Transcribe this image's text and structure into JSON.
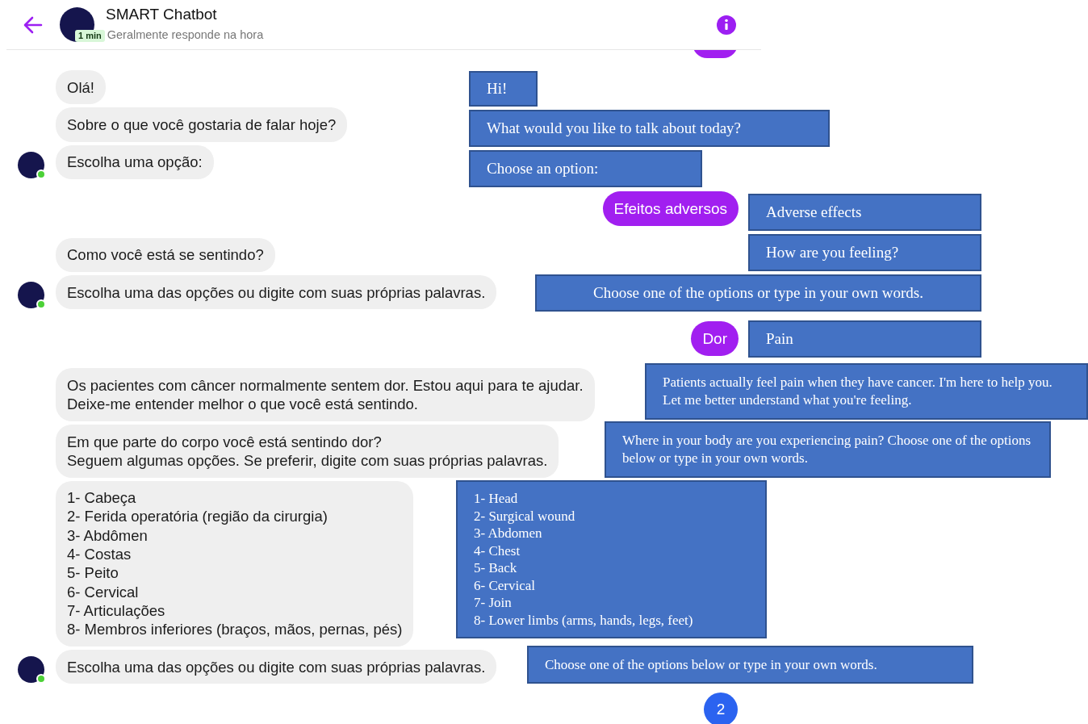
{
  "header": {
    "title": "SMART Chatbot",
    "badge": "1 min",
    "subtitle": "Geralmente responde na hora"
  },
  "messages": [
    {
      "kind": "bot",
      "lines": [
        "Olá!"
      ],
      "avatar": false
    },
    {
      "kind": "bot",
      "lines": [
        "Sobre o que você gostaria de falar hoje?"
      ],
      "avatar": false
    },
    {
      "kind": "bot",
      "lines": [
        "Escolha uma opção:"
      ],
      "avatar": true
    },
    {
      "kind": "user",
      "lines": [
        "Efeitos adversos"
      ]
    },
    {
      "kind": "bot",
      "lines": [
        "Como você está se sentindo?"
      ],
      "avatar": false
    },
    {
      "kind": "bot",
      "lines": [
        "Escolha uma das opções ou digite com suas próprias palavras."
      ],
      "avatar": true
    },
    {
      "kind": "user",
      "lines": [
        "Dor"
      ]
    },
    {
      "kind": "bot",
      "lines": [
        "Os pacientes com câncer normalmente sentem dor. Estou aqui para te ajudar.",
        "Deixe-me entender melhor o que você está sentindo."
      ],
      "avatar": false
    },
    {
      "kind": "bot",
      "lines": [
        "Em que parte do corpo você está sentindo dor?",
        "Seguem algumas opções. Se preferir, digite com suas próprias palavras."
      ],
      "avatar": false
    },
    {
      "kind": "bot",
      "lines": [
        "1- Cabeça",
        "2- Ferida operatória (região da cirurgia)",
        "3- Abdômen",
        "4- Costas",
        "5- Peito",
        "6- Cervical",
        "7- Articulações",
        "8- Membros inferiores (braços, mãos, pernas, pés)"
      ],
      "avatar": false
    },
    {
      "kind": "bot",
      "lines": [
        "Escolha uma das opções ou digite com suas próprias palavras."
      ],
      "avatar": true
    }
  ],
  "unread_count": "2",
  "translations": [
    {
      "lines": [
        "Hi!"
      ]
    },
    {
      "lines": [
        "What would you like to talk about today?"
      ]
    },
    {
      "lines": [
        "Choose an option:"
      ]
    },
    {
      "lines": [
        "Adverse effects"
      ]
    },
    {
      "lines": [
        "How are you feeling?"
      ]
    },
    {
      "lines": [
        "Choose one of the options or type in your own words."
      ]
    },
    {
      "lines": [
        "Pain"
      ]
    },
    {
      "lines": [
        "Patients actually feel pain when they have cancer. I'm here to help you. Let me better understand what you're feeling."
      ]
    },
    {
      "lines": [
        "Where in your body are you experiencing pain? Choose one of the options below or type in your own words."
      ]
    },
    {
      "lines": [
        "1- Head",
        "2- Surgical wound",
        "3- Abdomen",
        "4- Chest",
        "5- Back",
        "6- Cervical",
        "7- Join",
        "8- Lower limbs (arms, hands, legs, feet)"
      ]
    },
    {
      "lines": [
        "Choose one of the options below or type in your own words."
      ]
    }
  ]
}
